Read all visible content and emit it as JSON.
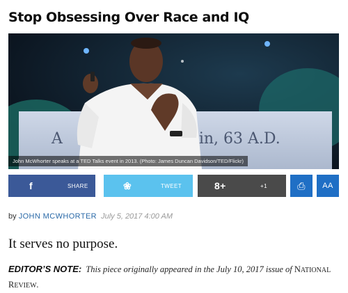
{
  "article": {
    "headline": "Stop Obsessing Over Race and IQ",
    "caption": "John McWhorter speaks at a TED Talks event in 2013. (Photo: James Duncan Davidson/TED/Flickr)",
    "slide_text": "tin, 63 A.D.",
    "slide_text_left": "A"
  },
  "share": {
    "facebook_label": "SHARE",
    "facebook_icon": "f",
    "twitter_label": "TWEET",
    "twitter_icon": "❀",
    "gplus_icon": "8+",
    "gplus_label": "+1",
    "print_icon": "⎙",
    "font_size_icon": "AA"
  },
  "byline": {
    "prefix": "by",
    "author": "JOHN MCWHORTER",
    "date": "July 5, 2017 4:00 AM"
  },
  "subhead": "It serves no purpose.",
  "editors_note": {
    "label": "EDITOR’S NOTE:",
    "text_before": "This piece originally appeared in the July 10, 2017 issue of",
    "pub_first_initial": "N",
    "pub_first_rest": "ATIONAL",
    "pub_second_initial": "R",
    "pub_second_rest": "EVIEW",
    "end": "."
  },
  "colors": {
    "facebook": "#3b5998",
    "twitter": "#5bc2ee",
    "gplus": "#4a4a4a",
    "tool": "#1f6fc5",
    "author_link": "#2b6aa8"
  }
}
